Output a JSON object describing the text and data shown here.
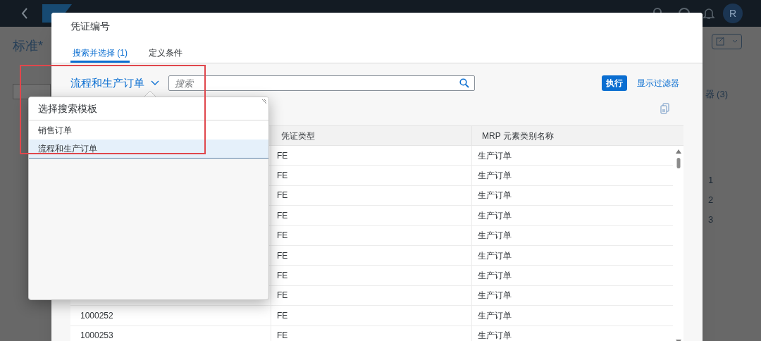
{
  "shell": {
    "avatar": "R"
  },
  "background": {
    "variant_title": "标准*",
    "filter_button": "器 (3)",
    "row_numbers": [
      "1",
      "2",
      "3"
    ]
  },
  "dialog": {
    "title": "凭证编号",
    "tabs": [
      {
        "label": "搜索并选择 (1)",
        "selected": true
      },
      {
        "label": "定义条件",
        "selected": false
      }
    ],
    "template_selector": {
      "label": "流程和生产订单"
    },
    "search": {
      "placeholder": "搜索"
    },
    "go_button": "执行",
    "show_filters": "显示过滤器",
    "table": {
      "columns": [
        "凭证类型",
        "MRP 元素类别名称"
      ],
      "rows": [
        {
          "document_type": "FE",
          "mrp_element": "生产订单"
        },
        {
          "document_type": "FE",
          "mrp_element": "生产订单"
        },
        {
          "document_type": "FE",
          "mrp_element": "生产订单"
        },
        {
          "document_type": "FE",
          "mrp_element": "生产订单"
        },
        {
          "document_type": "FE",
          "mrp_element": "生产订单"
        },
        {
          "document_type": "FE",
          "mrp_element": "生产订单"
        },
        {
          "document_type": "FE",
          "mrp_element": "生产订单"
        },
        {
          "document_type": "FE",
          "mrp_element": "生产订单"
        },
        {
          "column_1": "1000252",
          "document_type": "FE",
          "mrp_element": "生产订单"
        },
        {
          "column_1": "1000253",
          "document_type": "FE",
          "mrp_element": "生产订单"
        }
      ]
    }
  },
  "popover": {
    "title": "选择搜索模板",
    "items": [
      {
        "label": "销售订单",
        "selected": false
      },
      {
        "label": "流程和生产订单",
        "selected": true
      }
    ]
  }
}
